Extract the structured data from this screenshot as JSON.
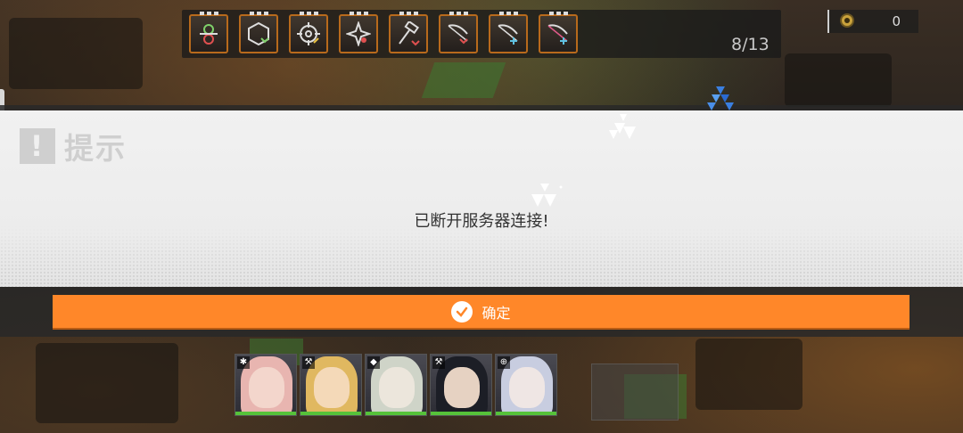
{
  "top_bar": {
    "item_icons": [
      "heal-icon",
      "shield-box-icon",
      "crosshair-icon",
      "burst-icon",
      "hammer-icon",
      "bow-icon",
      "bow-icon",
      "bow-icon"
    ],
    "progress": "8/13",
    "currency_value": "0"
  },
  "dialog": {
    "title": "提示",
    "badge_glyph": "!",
    "message": "已断开服务器连接!",
    "confirm_label": "确定"
  },
  "roster": {
    "members": [
      {
        "class_icon": "✱",
        "hair": "#e8b5b0",
        "face": "#f3d6cc"
      },
      {
        "class_icon": "⚒",
        "hair": "#e0b860",
        "face": "#f4d9b8"
      },
      {
        "class_icon": "◆",
        "hair": "#cfd4c8",
        "face": "#ece6dc"
      },
      {
        "class_icon": "⚒",
        "hair": "#1c1e26",
        "face": "#e6d2c2"
      },
      {
        "class_icon": "⊕",
        "hair": "#c8cde0",
        "face": "#efe6e4"
      }
    ]
  },
  "colors": {
    "accent": "#ff8729",
    "slot_border": "#b86a1c",
    "hp_green": "#56c23a"
  }
}
